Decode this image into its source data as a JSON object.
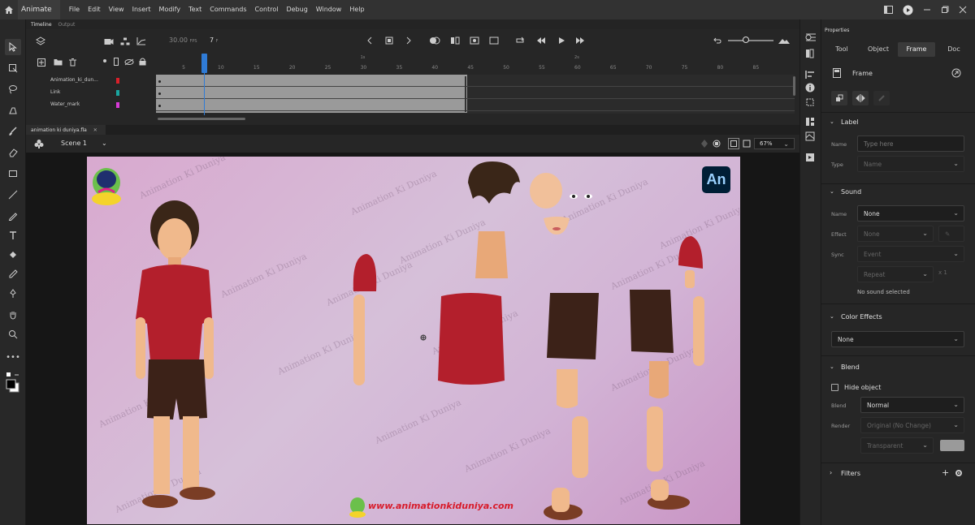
{
  "menubar": {
    "app_name": "Animate",
    "items": [
      "File",
      "Edit",
      "View",
      "Insert",
      "Modify",
      "Text",
      "Commands",
      "Control",
      "Debug",
      "Window",
      "Help"
    ]
  },
  "timeline": {
    "tabs": [
      "Timeline",
      "Output"
    ],
    "fps": "30.00",
    "fps_unit": "FPS",
    "current_frame": "7",
    "frame_unit": "F",
    "ruler_labels": [
      "5",
      "10",
      "15",
      "20",
      "25",
      "30",
      "35",
      "40",
      "45",
      "50",
      "55",
      "60",
      "65",
      "70",
      "75",
      "80",
      "85"
    ],
    "ruler_seconds": [
      "1s",
      "2s"
    ],
    "layers": [
      {
        "name": "Animation_ki_dun...",
        "color": "#d9202a"
      },
      {
        "name": "Link",
        "color": "#1aa6a0"
      },
      {
        "name": "Water_mark",
        "color": "#d63ad6"
      }
    ]
  },
  "document": {
    "tab_name": "animation ki duniya.fla",
    "scene_name": "Scene 1",
    "zoom": "67%"
  },
  "stage": {
    "watermark": "Animation Ki Duniya",
    "website": "www.animationkiduniya.com",
    "an_logo": "An",
    "logo_text": "Animation Ki Duniya"
  },
  "properties": {
    "title": "Properties",
    "tabs": [
      "Tool",
      "Object",
      "Frame",
      "Doc"
    ],
    "active_tab": "Frame",
    "header_label": "Frame",
    "label_section": {
      "title": "Label",
      "name_label": "Name",
      "name_placeholder": "Type here",
      "type_label": "Type",
      "type_value": "Name"
    },
    "sound_section": {
      "title": "Sound",
      "name_label": "Name",
      "name_value": "None",
      "effect_label": "Effect",
      "effect_value": "None",
      "sync_label": "Sync",
      "sync_value": "Event",
      "repeat_value": "Repeat",
      "repeat_count": "x 1",
      "status": "No sound selected"
    },
    "color_effects": {
      "title": "Color Effects",
      "value": "None"
    },
    "blend_section": {
      "title": "Blend",
      "hide_object_label": "Hide object",
      "blend_label": "Blend",
      "blend_value": "Normal",
      "render_label": "Render",
      "render_value": "Original (No Change)",
      "transparent_value": "Transparent"
    },
    "filters": {
      "title": "Filters"
    }
  }
}
